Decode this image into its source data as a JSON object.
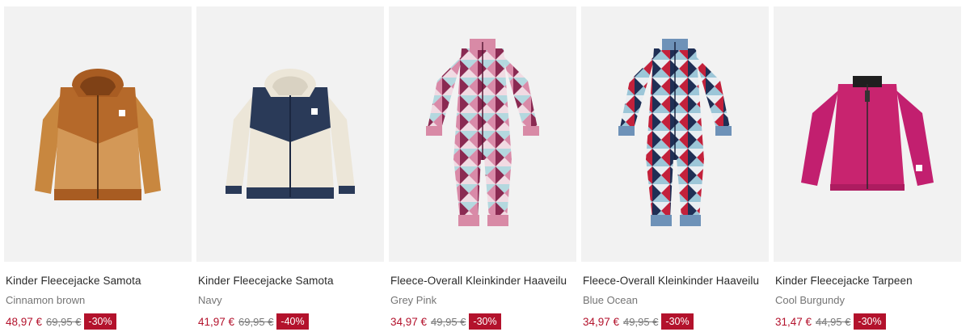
{
  "products": [
    {
      "name": "Kinder Fleecejacke Samota",
      "color": "Cinnamon brown",
      "price": "48,97 €",
      "old_price": "69,95 €",
      "discount": "-30%",
      "image_icon": "brown-fleece-jacket-image"
    },
    {
      "name": "Kinder Fleecejacke Samota",
      "color": "Navy",
      "price": "41,97 €",
      "old_price": "69,95 €",
      "discount": "-40%",
      "image_icon": "navy-cream-fleece-jacket-image"
    },
    {
      "name": "Fleece-Overall Kleinkinder Haaveilu",
      "color": "Grey Pink",
      "price": "34,97 €",
      "old_price": "49,95 €",
      "discount": "-30%",
      "image_icon": "pink-patterned-overall-image"
    },
    {
      "name": "Fleece-Overall Kleinkinder Haaveilu",
      "color": "Blue Ocean",
      "price": "34,97 €",
      "old_price": "49,95 €",
      "discount": "-30%",
      "image_icon": "blue-patterned-overall-image"
    },
    {
      "name": "Kinder Fleecejacke Tarpeen",
      "color": "Cool Burgundy",
      "price": "31,47 €",
      "old_price": "44,95 €",
      "discount": "-30%",
      "image_icon": "burgundy-fleece-jacket-image"
    }
  ],
  "colors": {
    "sale_red": "#b3122c",
    "image_bg": "#f2f2f2",
    "text": "#2a2a2a",
    "muted": "#757575"
  }
}
